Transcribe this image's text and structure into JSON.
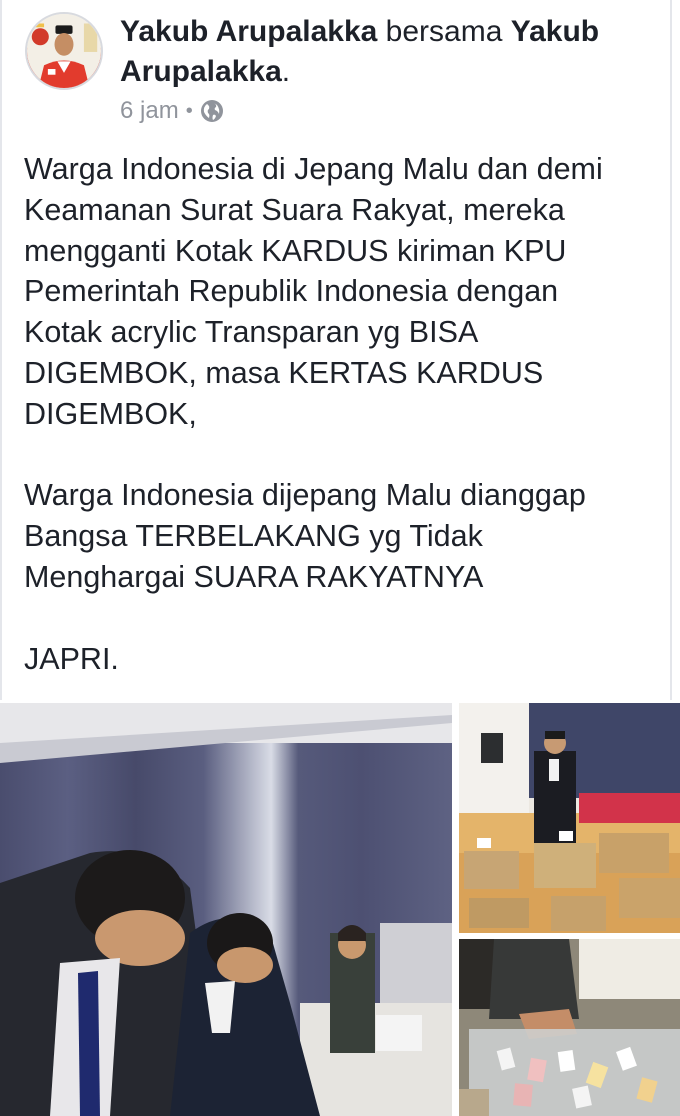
{
  "post": {
    "author_name": "Yakub Arupalakka",
    "with_word": " bersama ",
    "tagged_name": "Yakub Arupalakka",
    "tagged_suffix": ".",
    "time": "6 jam",
    "separator": "•",
    "privacy_icon": "globe-icon",
    "body": "Warga Indonesia di Jepang Malu dan demi\nKeamanan Surat Suara Rakyat, mereka\nmengganti Kotak KARDUS kiriman KPU\nPemerintah Republik Indonesia dengan\nKotak acrylic Transparan yg BISA\nDIGEMBOK, masa KERTAS KARDUS\nDIGEMBOK,\n\nWarga Indonesia dijepang Malu dianggap\nBangsa TERBELAKANG yg Tidak\nMenghargai SUARA RAKYATNYA\n\nJAPRI."
  },
  "colors": {
    "text_primary": "#1d2129",
    "text_secondary": "#90949c",
    "divider": "#e4e6eb"
  }
}
